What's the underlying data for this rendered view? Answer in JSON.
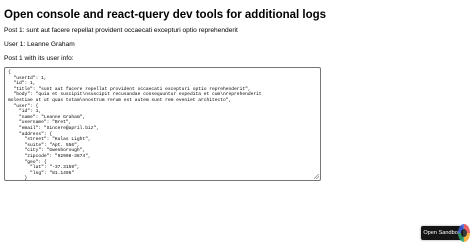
{
  "page": {
    "title": "Open console and react-query dev tools for additional logs",
    "post_line": "Post 1: sunt aut facere repellat provident occaecati excepturi optio reprehenderit",
    "user_line": "User 1: Leanne Graham",
    "combined_heading": "Post 1 with its user info:",
    "json_text": "{\n  \"userId\": 1,\n  \"id\": 1,\n  \"title\": \"sunt aut facere repellat provident occaecati excepturi optio reprehenderit\",\n  \"body\": \"quia et suscipit\\nsuscipit recusandae consequuntur expedita et cum\\nreprehenderit\nmolestiae ut ut quas totam\\nnostrum rerum est autem sunt rem eveniet architecto\",\n  \"user\": {\n    \"id\": 1,\n    \"name\": \"Leanne Graham\",\n    \"username\": \"Bret\",\n    \"email\": \"Sincere@april.biz\",\n    \"address\": {\n      \"street\": \"Kulas Light\",\n      \"suite\": \"Apt. 556\",\n      \"city\": \"Gwenborough\",\n      \"zipcode\": \"92998-3874\",\n      \"geo\": {\n        \"lat\": \"-37.3159\",\n        \"lng\": \"81.1496\"\n      }"
  },
  "sandbox": {
    "button_label": "Open Sandbox",
    "logo_icon": "codesandbox-logo-icon"
  }
}
